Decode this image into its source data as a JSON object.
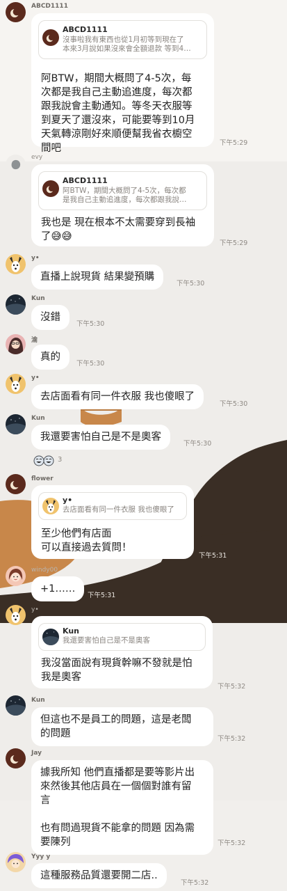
{
  "messages": [
    {
      "sender": "ABCD1111",
      "avatar_icon": "moon-avatar-icon",
      "quote": {
        "name": "ABCD1111",
        "text": "沒事啦我有東西也從1月初等到現在了\n本來3月說如果沒來會全額退款 等到4…"
      },
      "text": "阿BTW，期間大概問了4-5次，每\n次都是我自己主動追進度，每次都\n跟我說會主動通知。等冬天衣服等\n到夏天了還沒來，可能要等到10月\n天氣轉涼剛好來順便幫我省衣櫥空\n間吧",
      "time": "下午5:29"
    },
    {
      "sender": "evy",
      "avatar_icon": "stone-avatar-icon",
      "quote": {
        "name": "ABCD1111",
        "text": "阿BTW，期間大概問了4-5次，每次都\n是我自己主動追進度，每次都跟我說…"
      },
      "text": "我也是 現在根本不太需要穿到長袖\n了😅😅",
      "time": "下午5:29"
    },
    {
      "sender": "y•",
      "avatar_icon": "dog-avatar-icon",
      "text": "直播上說現貨 結果變預購",
      "time": "下午5:30"
    },
    {
      "sender": "Kun",
      "avatar_icon": "night-sky-avatar-icon",
      "text": "沒錯",
      "time": "下午5:30"
    },
    {
      "sender": "渝",
      "avatar_icon": "girl-avatar-icon",
      "text": "真的",
      "time": "下午5:30"
    },
    {
      "sender": "y•",
      "avatar_icon": "dog-avatar-icon",
      "text": "去店面看有同一件衣服 我也傻眼了",
      "time": "下午5:30"
    },
    {
      "sender": "Kun",
      "avatar_icon": "night-sky-avatar-icon",
      "text": "我還要害怕自己是不是奧客",
      "time": "下午5:30"
    },
    {
      "sender": "flower",
      "avatar_icon": "moon-avatar-icon",
      "quote": {
        "name": "y•",
        "text": "去店面看有同一件衣服 我也傻眼了"
      },
      "text": "至少他們有店面\n可以直接過去質問！",
      "time": "下午5:31"
    },
    {
      "sender": "windy00",
      "avatar_icon": "woman-avatar-icon",
      "text": "+1……",
      "time": "下午5:31"
    },
    {
      "sender": "y•",
      "avatar_icon": "dog-avatar-icon",
      "quote": {
        "name": "Kun",
        "text": "我還要害怕自己是不是奧客"
      },
      "text": "我沒當面說有現貨幹嘛不發就是怕\n我是奧客",
      "time": "下午5:32"
    },
    {
      "sender": "Kun",
      "avatar_icon": "night-sky-avatar-icon",
      "text": "但這也不是員工的問題，這是老闆\n的問題",
      "time": "下午5:32"
    },
    {
      "sender": "Jay",
      "avatar_icon": "moon-avatar-icon",
      "text": "據我所知 他們直播都是要等影片出\n來然後其他店員在一個個對誰有留\n言\n\n也有問過現貨不能拿的問題 因為需\n要陳列",
      "time": "下午5:32"
    },
    {
      "sender": "Yyy y",
      "avatar_icon": "purple-hair-avatar-icon",
      "text": "這種服務品質還要開二店..",
      "time": "下午5:32"
    }
  ],
  "reactions": {
    "icons": "laughing-faces-icon",
    "count": "3"
  },
  "colors": {
    "background": "#efedea",
    "bubble": "#ffffff",
    "wave_dark": "#3a2e25",
    "wave_light": "#c8874a",
    "accent_brown": "#5b2a1d"
  }
}
